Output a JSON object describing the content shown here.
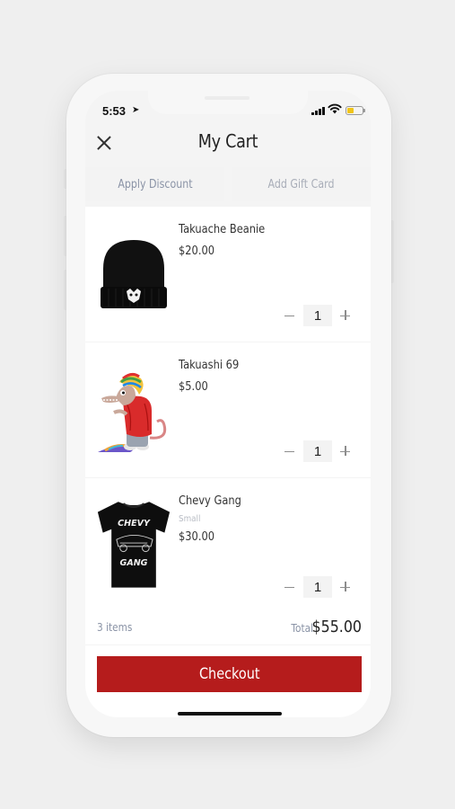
{
  "status": {
    "time": "5:53"
  },
  "header": {
    "title": "My Cart"
  },
  "actions": {
    "apply_discount": "Apply Discount",
    "add_gift_card": "Add Gift Card"
  },
  "cart": {
    "items": [
      {
        "name": "Takuache Beanie",
        "variant": "",
        "price": "$20.00",
        "quantity": "1",
        "image": "black-beanie"
      },
      {
        "name": "Takuashi 69",
        "variant": "",
        "price": "$5.00",
        "quantity": "1",
        "image": "cartoon-character"
      },
      {
        "name": "Chevy Gang",
        "variant": "Small",
        "price": "$30.00",
        "quantity": "1",
        "image": "black-tshirt"
      }
    ]
  },
  "summary": {
    "items_count": "3 items",
    "total_label": "Total",
    "total_value": "$55.00"
  },
  "checkout": {
    "label": "Checkout"
  },
  "colors": {
    "accent": "#b51c1c",
    "muted_text": "#8a93a6",
    "battery": "#f0c419"
  }
}
